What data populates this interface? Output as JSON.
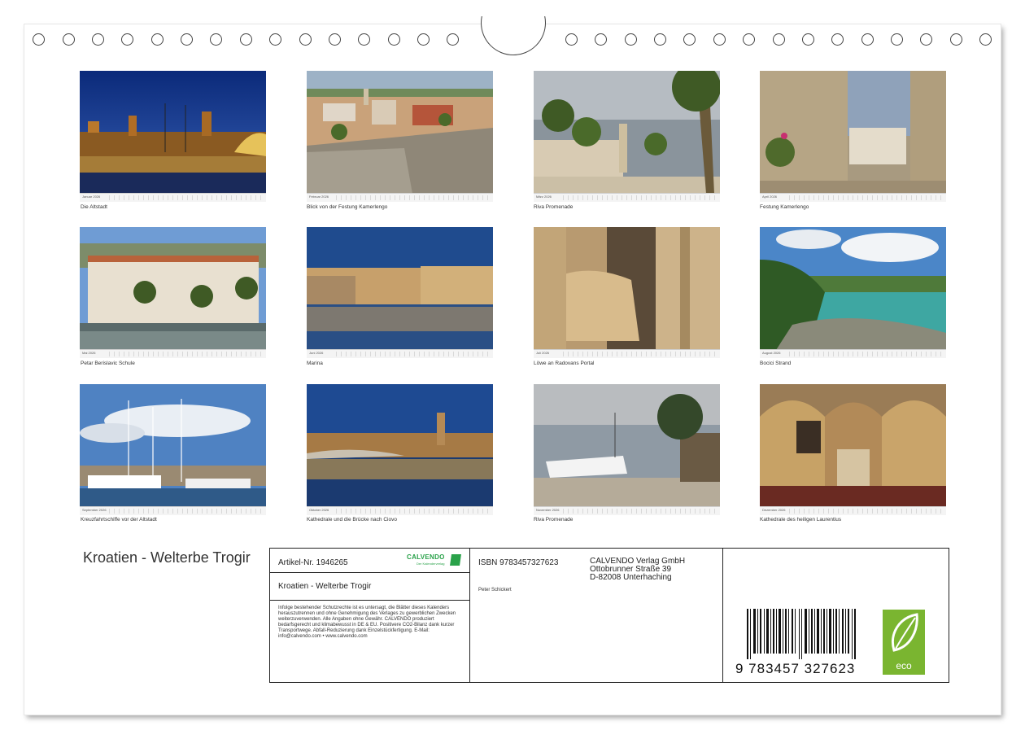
{
  "photos": [
    {
      "caption": "Die Altstadt",
      "month": "Januar 2026"
    },
    {
      "caption": "Blick von der Festung Kamerlengo",
      "month": "Februar 2026"
    },
    {
      "caption": "Riva Promenade",
      "month": "März 2026"
    },
    {
      "caption": "Festung Kamerlengo",
      "month": "April 2026"
    },
    {
      "caption": "Petar Berislavic Schule",
      "month": "Mai 2026"
    },
    {
      "caption": "Marina",
      "month": "Juni 2026"
    },
    {
      "caption": "Löwe an Radovans Portal",
      "month": "Juli 2026"
    },
    {
      "caption": "Bocici Strand",
      "month": "August 2026"
    },
    {
      "caption": "Kreuzfahrtschiffe vor der Altstadt",
      "month": "September 2026"
    },
    {
      "caption": "Kathedrale und die Brücke nach Ciovo",
      "month": "Oktober 2026"
    },
    {
      "caption": "Riva Promenade",
      "month": "November 2026"
    },
    {
      "caption": "Kathedrale des heiligen Laurentius",
      "month": "Dezember 2026"
    }
  ],
  "calendar_title": "Kroatien - Welterbe Trogir",
  "info": {
    "article": "Artikel-Nr. 1946265",
    "brand": "CALVENDO",
    "brand_sub": "Der Kalenderverlag",
    "product_title": "Kroatien - Welterbe Trogir",
    "legal": "Infolge bestehender Schutzrechte ist es untersagt, die Blätter dieses Kalenders herauszutrennen und ohne Genehmigung des Verlages zu gewerblichen Zwecken weiterzuverwenden. Alle Angaben ohne Gewähr. CALVENDO produziert bedarfsgerecht und klimabewusst in DE & EU. Positivere CO2-Bilanz dank kurzer Transportwege. Abfall-Reduzierung dank Einzelstückfertigung. E-Mail: info@calvendo.com • www.calvendo.com",
    "isbn": "ISBN 9783457327623",
    "publisher": [
      "CALVENDO Verlag GmbH",
      "Ottobrunner Straße 39",
      "D-82008 Unterhaching"
    ],
    "author": "Peter Schickert",
    "barcode_digits": "9 783457 327623",
    "eco_label": "eco"
  },
  "colors": {
    "eco_green": "#7ab530",
    "brand_green": "#2aa24a"
  }
}
